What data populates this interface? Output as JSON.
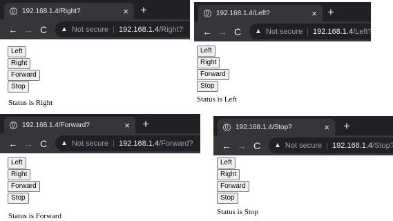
{
  "panels": [
    {
      "tab_title": "192.168.1.4/Right?",
      "close_glyph": "×",
      "newtab_glyph": "+",
      "warning_label": "Not secure",
      "separator": "|",
      "url_host": "192.168.1.4",
      "url_path": "/Right?",
      "buttons": [
        "Left",
        "Right",
        "Forward",
        "Stop"
      ],
      "status": "Status is Right"
    },
    {
      "tab_title": "192.168.1.4/Left?",
      "close_glyph": "×",
      "newtab_glyph": "+",
      "warning_label": "Not secure",
      "separator": "|",
      "url_host": "192.168.1.4",
      "url_path": "/Left?",
      "buttons": [
        "Left",
        "Right",
        "Forward",
        "Stop"
      ],
      "status": "Status is Left"
    },
    {
      "tab_title": "192.168.1.4/Forward?",
      "close_glyph": "×",
      "newtab_glyph": "+",
      "warning_label": "Not secure",
      "separator": "|",
      "url_host": "192.168.1.4",
      "url_path": "/Forward?",
      "buttons": [
        "Left",
        "Right",
        "Forward",
        "Stop"
      ],
      "status": "Status is Forward"
    },
    {
      "tab_title": "192.168.1.4/Stop?",
      "close_glyph": "×",
      "newtab_glyph": "+",
      "warning_label": "Not secure",
      "separator": "|",
      "url_host": "192.168.1.4",
      "url_path": "/Stop?",
      "buttons": [
        "Left",
        "Right",
        "Forward",
        "Stop"
      ],
      "status": "Status is Stop"
    }
  ],
  "icons": {
    "back": "arrow-left-icon",
    "forward": "arrow-right-icon",
    "reload": "reload-icon",
    "warning": "warning-triangle-icon",
    "favicon": "globe-icon"
  },
  "colors": {
    "chrome_dark": "#202124",
    "chrome_toolbar": "#35363a",
    "text_light": "#e8eaed",
    "text_dim": "#9aa0a6"
  }
}
